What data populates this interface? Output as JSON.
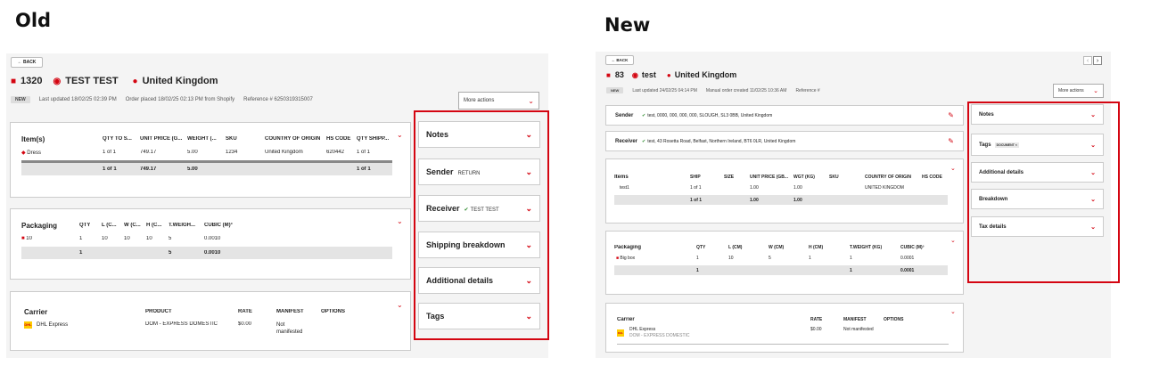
{
  "labels": {
    "old": "Old",
    "new": "New"
  },
  "colors": {
    "accent": "#d40511",
    "highlight_border": "#d40511",
    "dhl_yellow": "#ffcc00"
  },
  "old": {
    "back_label": "← BACK",
    "order_number": "1320",
    "customer_name": "TEST TEST",
    "country": "United Kingdom",
    "status_badge": "NEW",
    "last_updated": "Last updated 18/02/25 02:39 PM",
    "order_placed": "Order placed 18/02/25 02:13 PM from Shopify",
    "reference": "Reference # 6250319315007",
    "more_actions": "More actions",
    "items": {
      "headers": [
        "Item(s)",
        "QTY TO S...",
        "UNIT PRICE (G...",
        "WEIGHT (...",
        "SKU",
        "COUNTRY OF ORIGIN",
        "HS CODE",
        "QTY SHIPP..."
      ],
      "rows": [
        [
          "Dress",
          "1 of 1",
          "749.17",
          "5.00",
          "1234",
          "United Kingdom",
          "620442",
          "1 of 1"
        ]
      ],
      "total": [
        "",
        "1 of 1",
        "749.17",
        "5.00",
        "",
        "",
        "",
        "1 of 1"
      ]
    },
    "packaging": {
      "headers": [
        "Packaging",
        "QTY",
        "L (C...",
        "W (C...",
        "H (C...",
        "T.WEIGH...",
        "CUBIC (M)³"
      ],
      "rows": [
        [
          "10",
          "1",
          "10",
          "10",
          "10",
          "5",
          "0.0010"
        ]
      ],
      "total": [
        "",
        "1",
        "",
        "",
        "",
        "5",
        "0.0010"
      ]
    },
    "carrier": {
      "headers": [
        "Carrier",
        "PRODUCT",
        "RATE",
        "MANIFEST",
        "OPTIONS"
      ],
      "name": "DHL Express",
      "product": "DOM - EXPRESS DOMESTIC",
      "rate": "$0.00",
      "manifest": "Not manifested",
      "logo_text": "DHL"
    },
    "sidebar": [
      {
        "label": "Notes",
        "sub": ""
      },
      {
        "label": "Sender",
        "sub": "RETURN"
      },
      {
        "label": "Receiver",
        "sub": "TEST TEST"
      },
      {
        "label": "Shipping breakdown",
        "sub": ""
      },
      {
        "label": "Additional details",
        "sub": ""
      },
      {
        "label": "Tags",
        "sub": ""
      }
    ]
  },
  "new": {
    "back_label": "← BACK",
    "order_number": "83",
    "customer_name": "test",
    "country": "United Kingdom",
    "status_badge": "NEW",
    "last_updated": "Last updated 24/02/25 04:14 PM",
    "order_created": "Manual order created 11/02/25 10:36 AM",
    "reference": "Reference #",
    "more_actions": "More actions",
    "sender": {
      "label": "Sender",
      "value": "test, 0000, 000, 000, 000, SLOUGH, SL3 0BB, United Kingdom"
    },
    "receiver": {
      "label": "Receiver",
      "value": "test, 43 Rosetta Road, Belfast, Northern Ireland, BT6 0LR, United Kingdom"
    },
    "items": {
      "headers": [
        "Items",
        "SHIP",
        "SIZE",
        "UNIT PRICE (GB...",
        "WGT (KG)",
        "SKU",
        "COUNTRY OF ORIGIN",
        "HS CODE"
      ],
      "rows": [
        [
          "test1",
          "1 of 1",
          "",
          "1.00",
          "1.00",
          "",
          "UNITED KINGDOM",
          ""
        ]
      ],
      "total": [
        "",
        "1 of 1",
        "",
        "1.00",
        "1.00",
        "",
        "",
        ""
      ]
    },
    "packaging": {
      "headers": [
        "Packaging",
        "QTY",
        "L (CM)",
        "W (CM)",
        "H (CM)",
        "T.WEIGHT (KG)",
        "CUBIC (M)³"
      ],
      "rows": [
        [
          "Big box",
          "1",
          "10",
          "5",
          "1",
          "1",
          "0.0001"
        ]
      ],
      "total": [
        "",
        "1",
        "",
        "",
        "",
        "1",
        "0.0001"
      ]
    },
    "carrier": {
      "headers": [
        "Carrier",
        "RATE",
        "MANIFEST",
        "OPTIONS"
      ],
      "name": "DHL Express",
      "product": "DOM - EXPRESS DOMESTIC",
      "rate": "$0.00",
      "manifest": "Not manifested",
      "logo_text": "DHL"
    },
    "sidebar": [
      {
        "label": "Notes",
        "tag": ""
      },
      {
        "label": "Tags",
        "tag": "DOCUMENT ×"
      },
      {
        "label": "Additional details",
        "tag": ""
      },
      {
        "label": "Breakdown",
        "tag": ""
      },
      {
        "label": "Tax details",
        "tag": ""
      }
    ]
  }
}
